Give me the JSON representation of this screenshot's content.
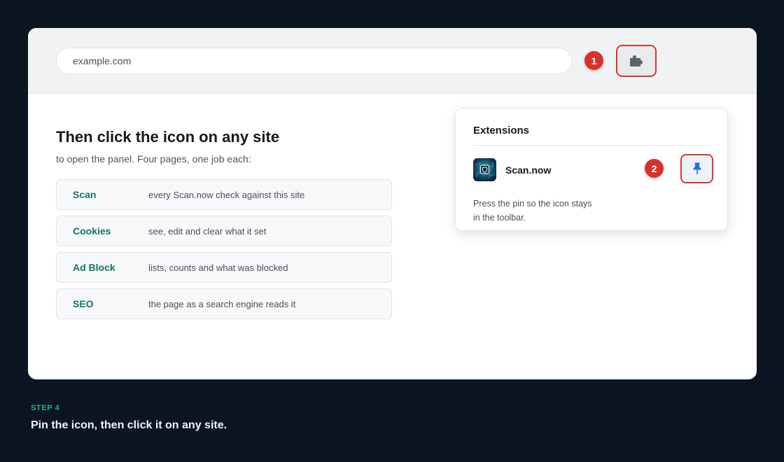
{
  "browser": {
    "url": "example.com",
    "step_one_number": "1",
    "extensions_icon": "puzzle-icon"
  },
  "content": {
    "title": "Then click the icon on any site",
    "subtitle": "to open the panel. Four pages, one job each:",
    "pages": [
      {
        "name": "Scan",
        "description": "every Scan.now check against this site"
      },
      {
        "name": "Cookies",
        "description": "see, edit and clear what it set"
      },
      {
        "name": "Ad Block",
        "description": "lists, counts and what was blocked"
      },
      {
        "name": "SEO",
        "description": "the page as a search engine reads it"
      }
    ]
  },
  "extensions_panel": {
    "title": "Extensions",
    "extension_name": "Scan.now",
    "step_two_number": "2",
    "pin_icon": "pin-icon",
    "note_line_1": "Press the pin so the icon stays",
    "note_line_2": "in the toolbar."
  },
  "step": {
    "label": "STEP 4",
    "caption": "Pin the icon, then click it on any site."
  },
  "colors": {
    "background": "#0d1422",
    "accent_teal": "#127566",
    "step_label": "#1fb39b",
    "highlight_red": "#d9302b",
    "pin_blue": "#1f6fe5"
  }
}
